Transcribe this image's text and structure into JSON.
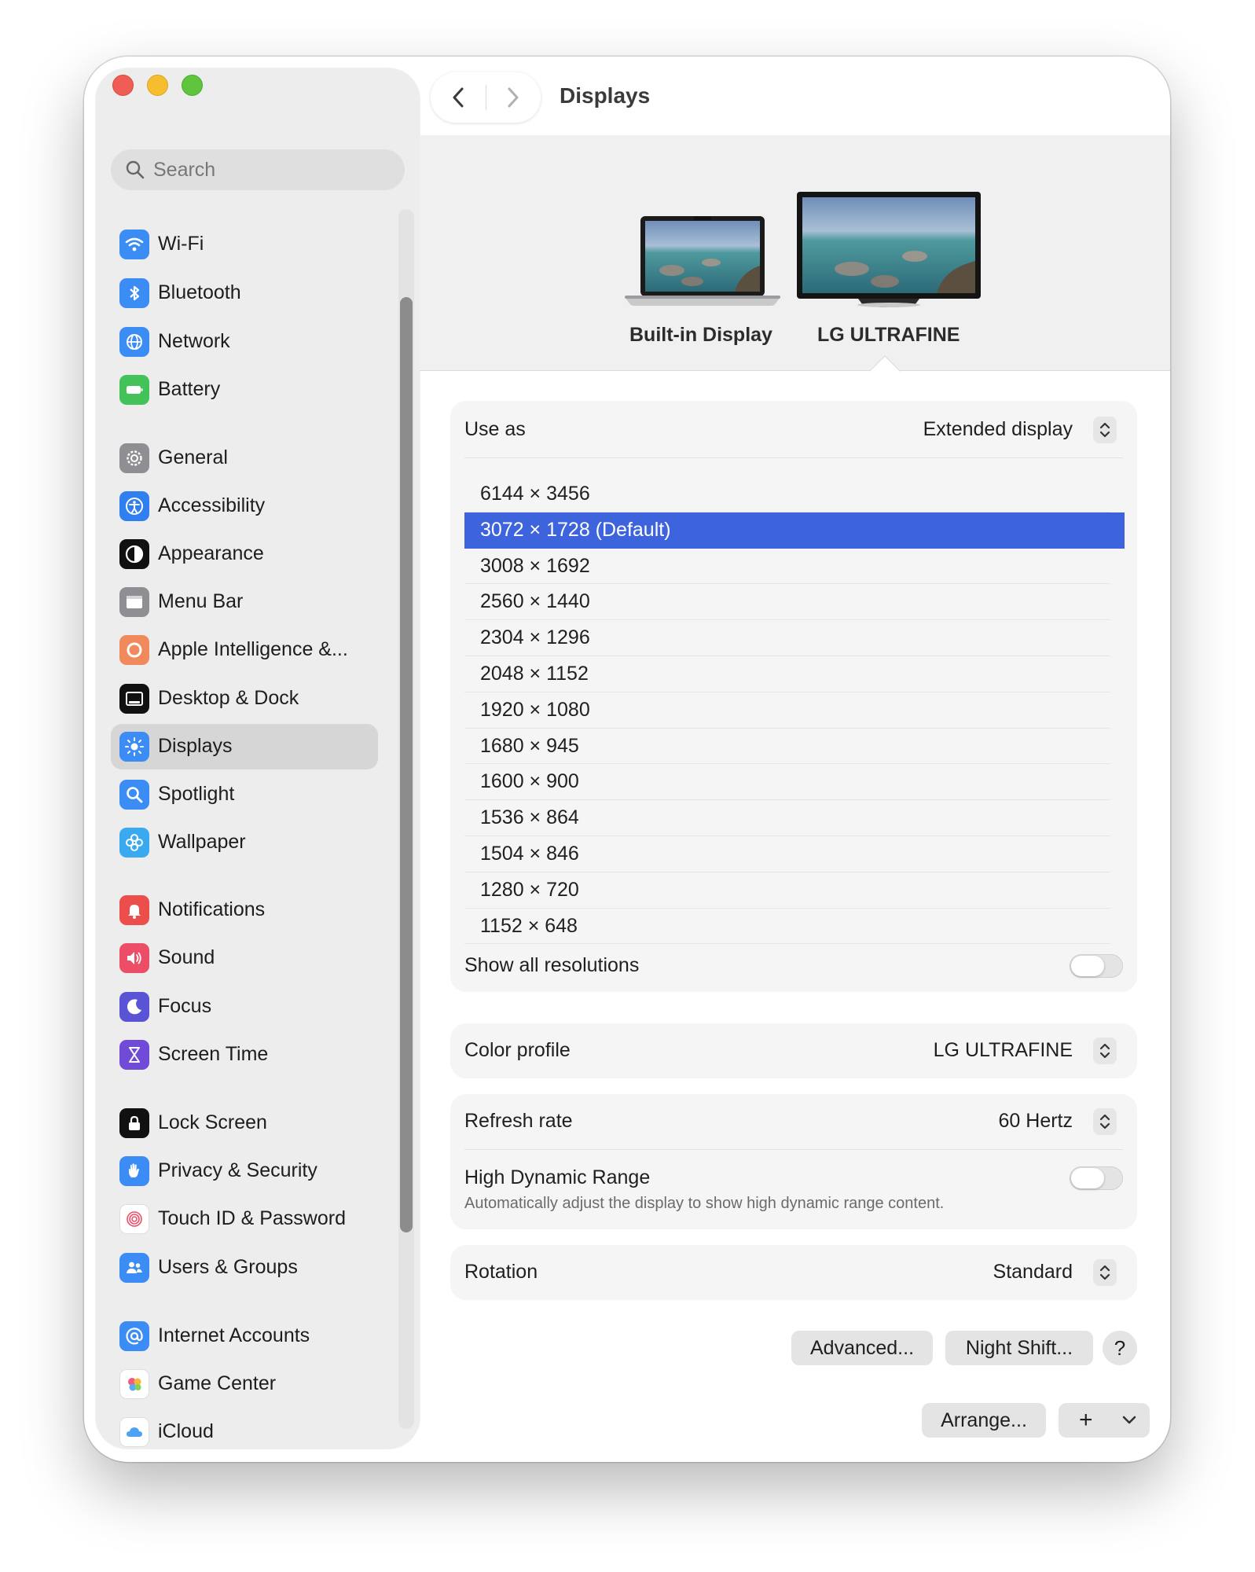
{
  "window": {
    "title": "Displays"
  },
  "search": {
    "placeholder": "Search"
  },
  "sidebar": {
    "items": [
      {
        "label": "Wi-Fi",
        "icon": "wifi-icon",
        "color": "#3b8cf5"
      },
      {
        "label": "Bluetooth",
        "icon": "bluetooth-icon",
        "color": "#3b8cf5"
      },
      {
        "label": "Network",
        "icon": "globe-icon",
        "color": "#3b8cf5"
      },
      {
        "label": "Battery",
        "icon": "battery-icon",
        "color": "#43c25a"
      },
      {
        "label": "General",
        "icon": "gear-icon",
        "color": "#8e8e93"
      },
      {
        "label": "Accessibility",
        "icon": "accessibility-icon",
        "color": "#2f7ff0"
      },
      {
        "label": "Appearance",
        "icon": "appearance-icon",
        "color": "#111111"
      },
      {
        "label": "Menu Bar",
        "icon": "menu-bar-icon",
        "color": "#8e8e93"
      },
      {
        "label": "Apple Intelligence &...",
        "icon": "apple-intelligence-icon",
        "color": "#f08a5d"
      },
      {
        "label": "Desktop & Dock",
        "icon": "dock-icon",
        "color": "#111111"
      },
      {
        "label": "Displays",
        "icon": "sun-icon",
        "color": "#3b8cf5"
      },
      {
        "label": "Spotlight",
        "icon": "magnifier-icon",
        "color": "#3b8cf5"
      },
      {
        "label": "Wallpaper",
        "icon": "flower-icon",
        "color": "#39a9f0"
      },
      {
        "label": "Notifications",
        "icon": "bell-icon",
        "color": "#eb4e4b"
      },
      {
        "label": "Sound",
        "icon": "speaker-icon",
        "color": "#eb4e66"
      },
      {
        "label": "Focus",
        "icon": "moon-icon",
        "color": "#5b53d6"
      },
      {
        "label": "Screen Time",
        "icon": "hourglass-icon",
        "color": "#6f4bd8"
      },
      {
        "label": "Lock Screen",
        "icon": "lock-icon",
        "color": "#111111"
      },
      {
        "label": "Privacy & Security",
        "icon": "hand-icon",
        "color": "#3b8cf5"
      },
      {
        "label": "Touch ID & Password",
        "icon": "fingerprint-icon",
        "color": "#ffffff"
      },
      {
        "label": "Users & Groups",
        "icon": "users-icon",
        "color": "#3b8cf5"
      },
      {
        "label": "Internet Accounts",
        "icon": "at-icon",
        "color": "#3b8cf5"
      },
      {
        "label": "Game Center",
        "icon": "game-center-icon",
        "color": "#ffffff"
      },
      {
        "label": "iCloud",
        "icon": "cloud-icon",
        "color": "#ffffff"
      }
    ],
    "selected": "Displays"
  },
  "monitors": [
    {
      "label": "Built-in Display",
      "icon": "laptop-icon"
    },
    {
      "label": "LG ULTRAFINE",
      "icon": "monitor-icon",
      "selected": true
    }
  ],
  "use_as": {
    "label": "Use as",
    "value": "Extended display"
  },
  "resolutions": [
    "6144 × 3456",
    "3072 × 1728 (Default)",
    "3008 × 1692",
    "2560 × 1440",
    "2304 × 1296",
    "2048 × 1152",
    "1920 × 1080",
    "1680 × 945",
    "1600 × 900",
    "1536 × 864",
    "1504 × 846",
    "1280 × 720",
    "1152 × 648"
  ],
  "selected_resolution": "3072 × 1728 (Default)",
  "show_all_resolutions": {
    "label": "Show all resolutions",
    "on": false
  },
  "color_profile": {
    "label": "Color profile",
    "value": "LG ULTRAFINE"
  },
  "refresh_rate": {
    "label": "Refresh rate",
    "value": "60 Hertz"
  },
  "hdr": {
    "label": "High Dynamic Range",
    "description": "Automatically adjust the display to show high dynamic range content.",
    "on": false
  },
  "rotation": {
    "label": "Rotation",
    "value": "Standard"
  },
  "buttons": {
    "advanced": "Advanced...",
    "night_shift": "Night Shift...",
    "help": "?",
    "arrange": "Arrange...",
    "add": "+"
  },
  "colors": {
    "accent": "#3d63dd"
  }
}
